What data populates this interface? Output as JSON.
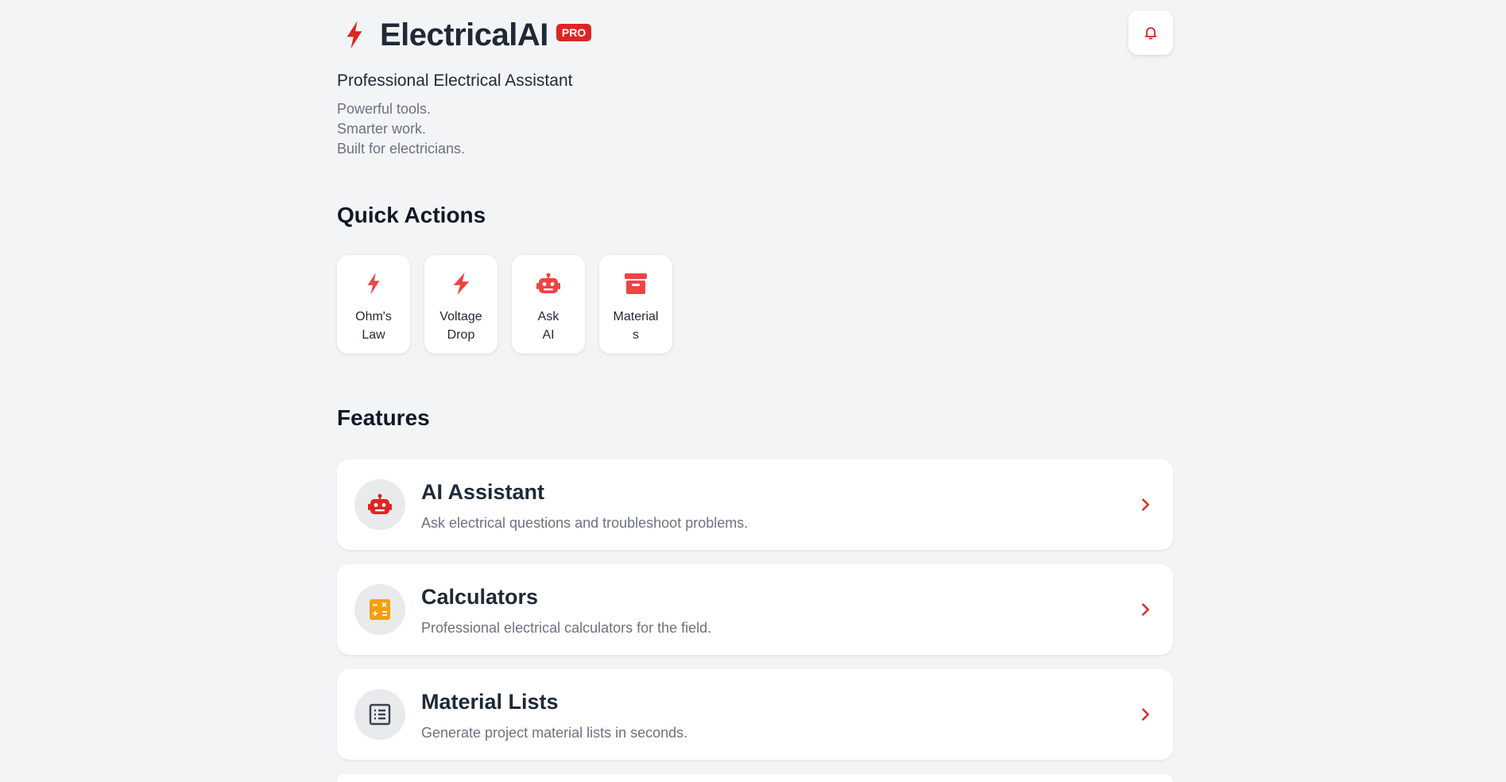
{
  "header": {
    "brand_name": "ElectricalAI",
    "badge": "PRO",
    "subtitle": "Professional Electrical Assistant",
    "tagline": [
      "Powerful tools.",
      "Smarter work.",
      "Built for electricians."
    ]
  },
  "sections": {
    "quick_actions_title": "Quick Actions",
    "features_title": "Features"
  },
  "quick_actions": [
    {
      "lines": [
        "Ohm's",
        "Law"
      ],
      "icon": "bolt-icon"
    },
    {
      "lines": [
        "Voltage",
        "Drop"
      ],
      "icon": "bolt-icon"
    },
    {
      "lines": [
        "Ask",
        "AI"
      ],
      "icon": "robot-icon"
    },
    {
      "lines": [
        "Material",
        "s"
      ],
      "icon": "archive-box-icon"
    }
  ],
  "features": [
    {
      "title": "AI Assistant",
      "description": "Ask electrical questions and troubleshoot problems.",
      "icon": "robot-icon"
    },
    {
      "title": "Calculators",
      "description": "Professional electrical calculators for the field.",
      "icon": "calculator-icon"
    },
    {
      "title": "Material Lists",
      "description": "Generate project material lists in seconds.",
      "icon": "list-icon"
    }
  ],
  "colors": {
    "accent": "#dc2626",
    "icon_red": "#ef4444",
    "calculator_orange": "#f59e0b",
    "list_dark": "#374151",
    "background": "#f3f4f6"
  }
}
